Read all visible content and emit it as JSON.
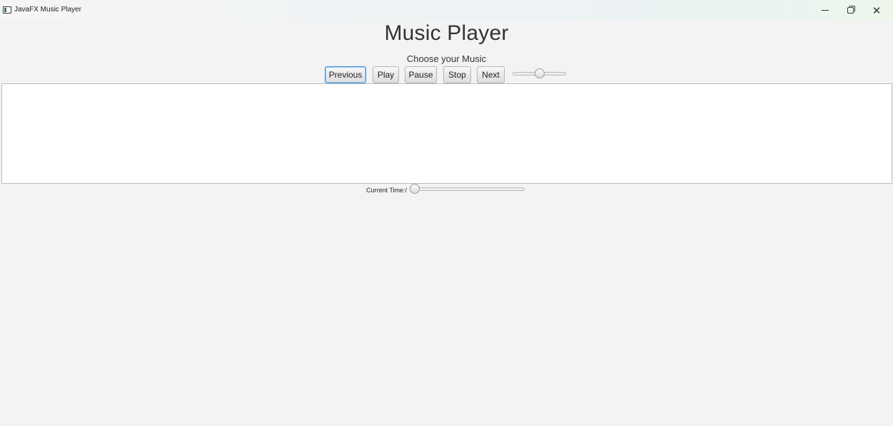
{
  "window": {
    "title": "JavaFX Music Player",
    "controls": {
      "minimize_glyph": "minimize-icon",
      "maximize_glyph": "restore-icon",
      "close_glyph": "close-icon"
    }
  },
  "header": {
    "title": "Music Player",
    "subtitle": "Choose your Music"
  },
  "controls": {
    "previous_label": "Previous",
    "play_label": "Play",
    "pause_label": "Pause",
    "stop_label": "Stop",
    "next_label": "Next",
    "volume_level": 0.5
  },
  "playlist": {
    "items": []
  },
  "playback": {
    "time_label": "Current Time:/",
    "progress": 0
  },
  "colors": {
    "background": "#f3f3f3",
    "focus_border": "#3d8fd6",
    "list_background": "#ffffff"
  }
}
